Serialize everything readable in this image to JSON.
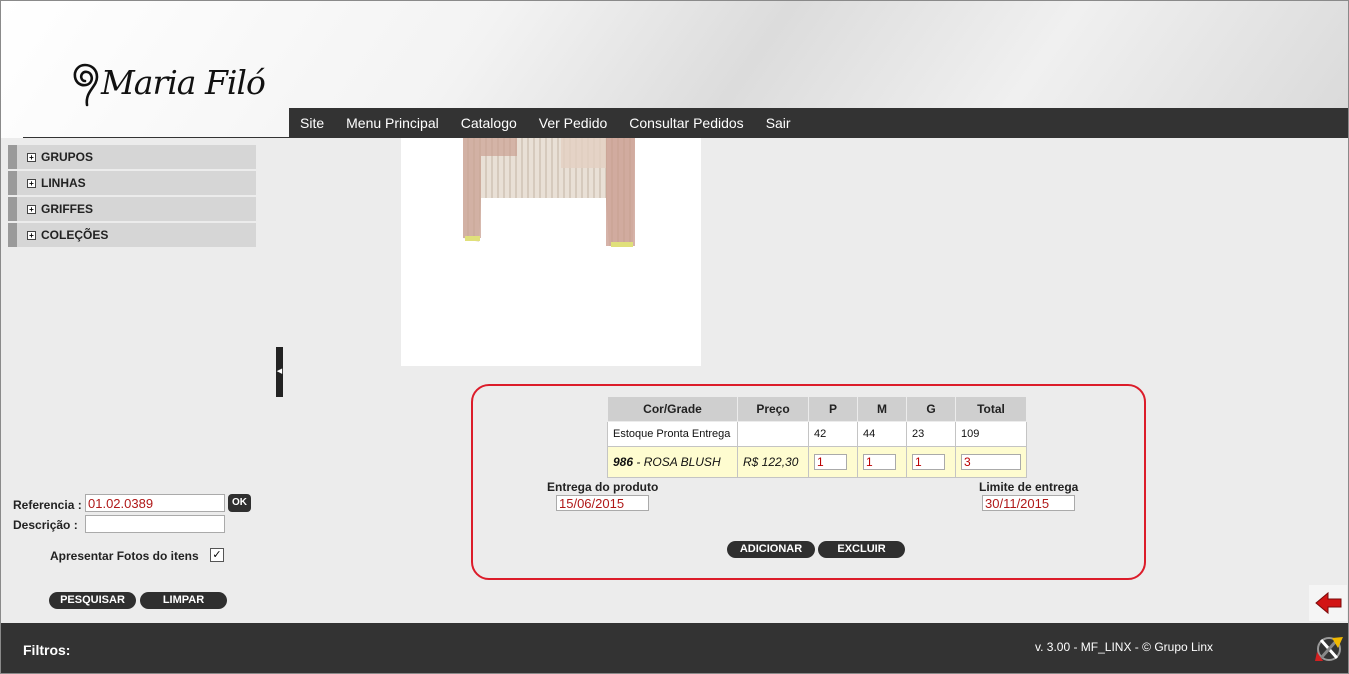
{
  "brand": {
    "logo_text": "Maria Filó"
  },
  "nav": {
    "items": [
      "Site",
      "Menu Principal",
      "Catalogo",
      "Ver Pedido",
      "Consultar Pedidos",
      "Sair"
    ]
  },
  "sidebar": {
    "items": [
      "GRUPOS",
      "LINHAS",
      "GRIFFES",
      "COLEÇÕES"
    ]
  },
  "grade": {
    "headers": [
      "Cor/Grade",
      "Preço",
      "P",
      "M",
      "G",
      "Total"
    ],
    "stock_row": {
      "label": "Estoque Pronta Entrega",
      "price": "",
      "p": "42",
      "m": "44",
      "g": "23",
      "total": "109"
    },
    "order_row": {
      "color_code": "986",
      "color_name": " - ROSA BLUSH",
      "price": "R$ 122,30",
      "p": "1",
      "m": "1",
      "g": "1",
      "total": "3"
    }
  },
  "delivery": {
    "entrega_label": "Entrega do produto",
    "entrega_value": "15/06/2015",
    "limite_label": "Limite de entrega",
    "limite_value": "30/11/2015"
  },
  "actions": {
    "add": "ADICIONAR",
    "delete": "EXCLUIR"
  },
  "filters": {
    "referencia_label": "Referencia :",
    "referencia_value": "01.02.0389",
    "ok_label": "OK",
    "descricao_label": "Descrição  :",
    "descricao_value": "",
    "fotos_label": "Apresentar Fotos do itens",
    "fotos_checked": true,
    "search_label": "PESQUISAR",
    "clear_label": "LIMPAR"
  },
  "footer": {
    "filtros_label": "Filtros:",
    "version": "v. 3.00 - MF_LINX - © Grupo Linx"
  },
  "colors": {
    "navbar": "#333333",
    "highlight_border": "#dc1c2a",
    "order_row_bg": "#fefcd0",
    "input_text": "#b01818"
  },
  "icons": [
    "plus-icon",
    "collapse-arrow-icon",
    "back-arrow-icon",
    "linx-logo-icon",
    "checkmark-icon"
  ]
}
